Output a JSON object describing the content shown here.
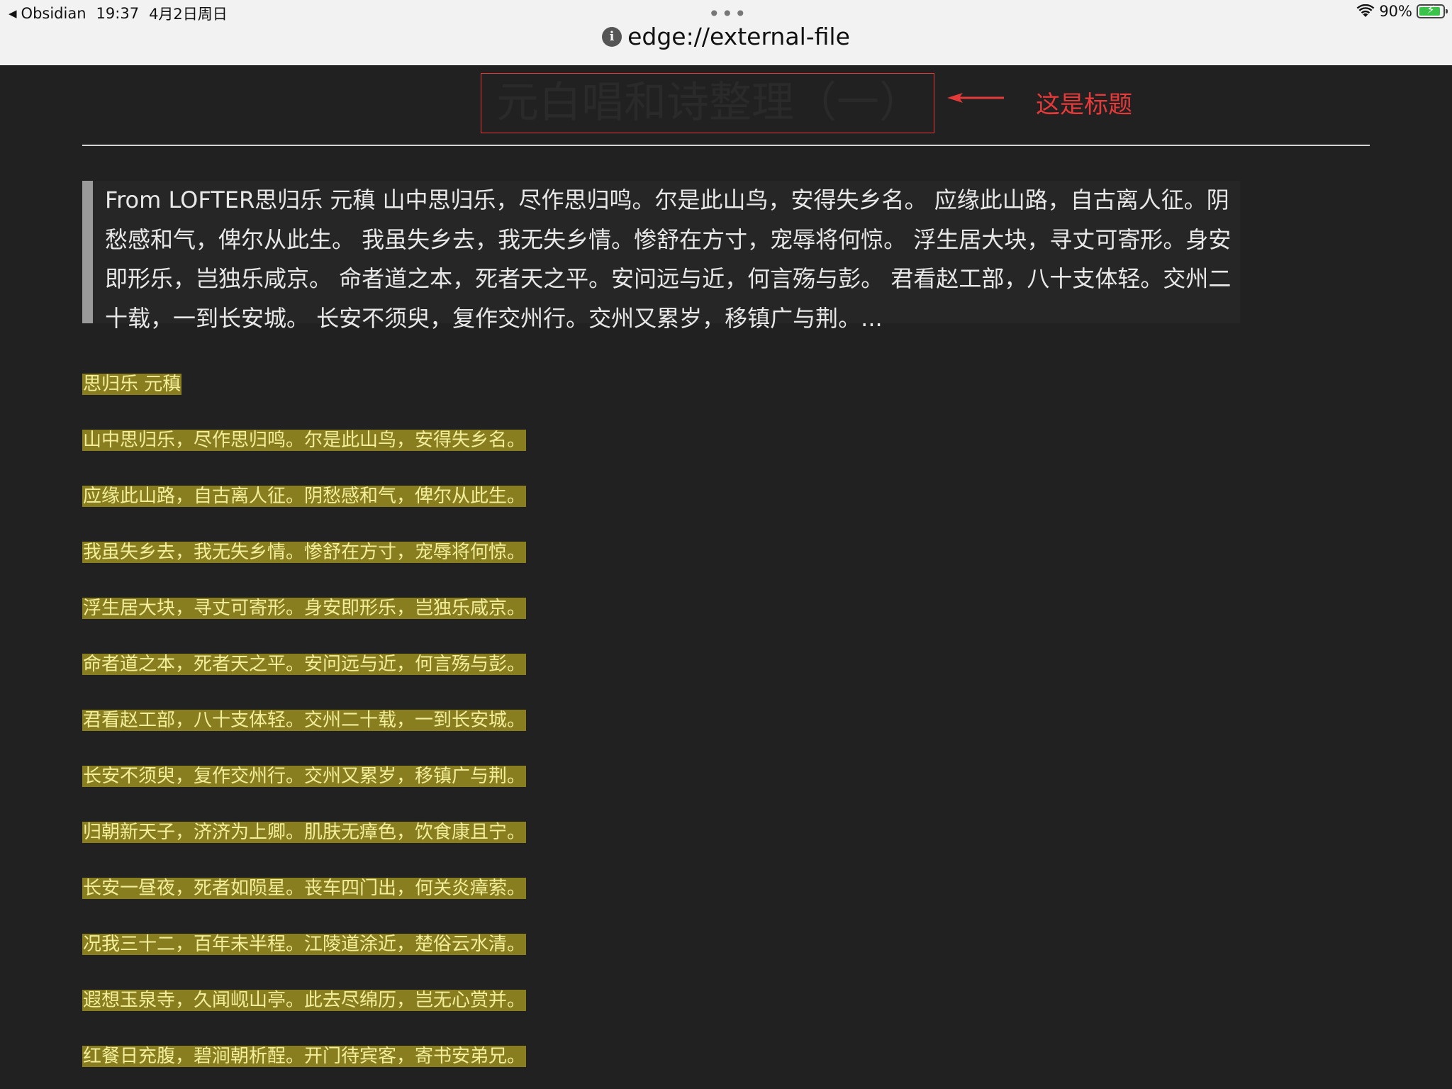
{
  "status_bar": {
    "back_app": "Obsidian",
    "time": "19:37",
    "date": "4月2日周日",
    "battery_percent": "90%",
    "battery_level": 0.9,
    "dots": "•••"
  },
  "address_bar": {
    "url": "edge://external-file",
    "info_icon": "i"
  },
  "page": {
    "title": "元白唱和诗整理（一）",
    "annotation": "这是标题",
    "quote": "From LOFTER思归乐 元稹 山中思归乐，尽作思归鸣。尔是此山鸟，安得失乡名。 应缘此山路，自古离人征。阴愁感和气，俾尔从此生。 我虽失乡去，我无失乡情。惨舒在方寸，宠辱将何惊。 浮生居大块，寻丈可寄形。身安即形乐，岂独乐咸京。 命者道之本，死者天之平。安问远与近，何言殇与彭。 君看赵工部，八十支体轻。交州二十载，一到长安城。 长安不须臾，复作交州行。交州又累岁，移镇广与荆。...",
    "poem_title": "思归乐  元稹",
    "poem_lines": [
      "山中思归乐，尽作思归鸣。尔是此山鸟，安得失乡名。",
      "应缘此山路，自古离人征。阴愁感和气，俾尔从此生。",
      "我虽失乡去，我无失乡情。惨舒在方寸，宠辱将何惊。",
      "浮生居大块，寻丈可寄形。身安即形乐，岂独乐咸京。",
      "命者道之本，死者天之平。安问远与近，何言殇与彭。",
      "君看赵工部，八十支体轻。交州二十载，一到长安城。",
      "长安不须臾，复作交州行。交州又累岁，移镇广与荆。",
      "归朝新天子，济济为上卿。肌肤无瘴色，饮食康且宁。",
      "长安一昼夜，死者如陨星。丧车四门出，何关炎瘴萦。",
      "况我三十二，百年未半程。江陵道涂近，楚俗云水清。",
      "遐想玉泉寺，久闻岘山亭。此去尽绵历，岂无心赏并。",
      "红餐日充腹，碧涧朝析酲。开门待宾客，寄书安弟兄。"
    ]
  },
  "colors": {
    "background": "#212121",
    "highlight_bg": "#887d1f",
    "highlight_text": "#f3ee9c",
    "annotation_red": "#e63a3a"
  }
}
